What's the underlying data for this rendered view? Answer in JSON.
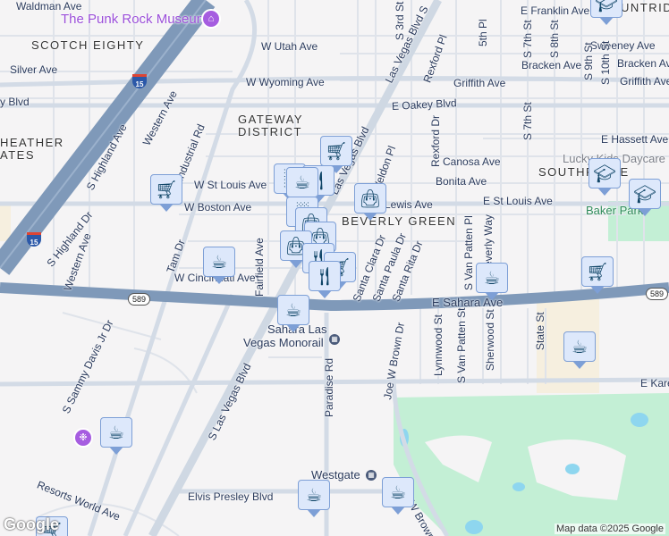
{
  "labels": {
    "waldman": "Waldman Ave",
    "punk": "The Punk Rock Museum",
    "scotch": "SCOTCH EIGHTY",
    "utah": "W Utah Ave",
    "silver": "Silver Ave",
    "wyoming": "W Wyoming Ave",
    "yblvd": "y Blvd",
    "heather1": "HEATHER",
    "heather2": "ATES",
    "gateway1": "GATEWAY",
    "gateway2": "DISTRICT",
    "highland_ave": "S Highland Ave",
    "western1": "Western Ave",
    "industrial": "Industrial Rd",
    "stlouis_w": "W St Louis Ave",
    "boston": "W Boston Ave",
    "highland_dr": "S Highland Dr",
    "western2": "Western Ave",
    "tam": "Tam Dr",
    "fairfield": "Fairfield Ave",
    "cincinnati": "W Cincinnati Ave",
    "sammy": "S Sammy Davis Jr Dr",
    "slvb": "S Las Vegas Blvd",
    "monorail1": "Sahara Las",
    "monorail2": "Vegas Monorail",
    "paradise": "Paradise Rd",
    "resorts": "Resorts World Ave",
    "elvis": "Elvis Presley Blvd",
    "westgate": "Westgate",
    "joe1": "Joe W Brown Dr",
    "joe2": "Joe W Brown Dr",
    "lvb_n": "Las Vegas Blvd",
    "lvb_s": "Las Vegas Blvd S",
    "third": "S 3rd St",
    "rexford_pl": "Rexford Pl",
    "fifth": "5th Pl",
    "franklin": "E Franklin Ave",
    "huntridge": "UNTRIDGE",
    "seventh1": "S 7th St",
    "eighth": "S 8th St",
    "sweeney": "Sweeney Ave",
    "bracken1": "Bracken Ave",
    "bracken2": "Bracken Ave",
    "griffith1": "Griffith Ave",
    "griffith2": "Griffith Ave",
    "ninth": "S 9th St",
    "tenth": "S 10th St",
    "oakey": "E Oakey Blvd",
    "weldon": "Weldon Pl",
    "rexford_dr1": "Rexford Dr",
    "seventh2": "S 7th St",
    "hassett": "E Hassett Ave",
    "canosa": "Canosa Ave",
    "lucky": "Lucky Kids Daycare",
    "southridge": "SOUTHRIDGE",
    "bonita": "Bonita Ave",
    "stlouis_e": "E St Louis Ave",
    "lewis": "Lewis Ave",
    "baker": "Baker Park",
    "beverly": "BEVERLY GREEN",
    "clara": "Santa Clara Dr",
    "paula": "Santa Paula Dr",
    "rita": "Santa Rita Dr",
    "vanpatten_pl": "S Van Patten Pl",
    "beverly_way": "Beverly Way",
    "sahara": "E Sahara Ave",
    "lynnwood": "Lynnwood St",
    "vanpatten_st": "S Van Patten St",
    "sherwood": "Sherwood St",
    "state": "State St",
    "karen": "E Karen Ave"
  },
  "shields": {
    "i15": "15",
    "sr589": "589"
  },
  "credit": "Map data ©2025 Google",
  "logo": "Google",
  "colors": {
    "marker_bg": "#dde8fb",
    "marker_border": "#7d9fd6",
    "icon": "#0e4466",
    "freeway": "#8da5c2",
    "park": "#c3efd5",
    "poi": "#9b4fd9"
  }
}
